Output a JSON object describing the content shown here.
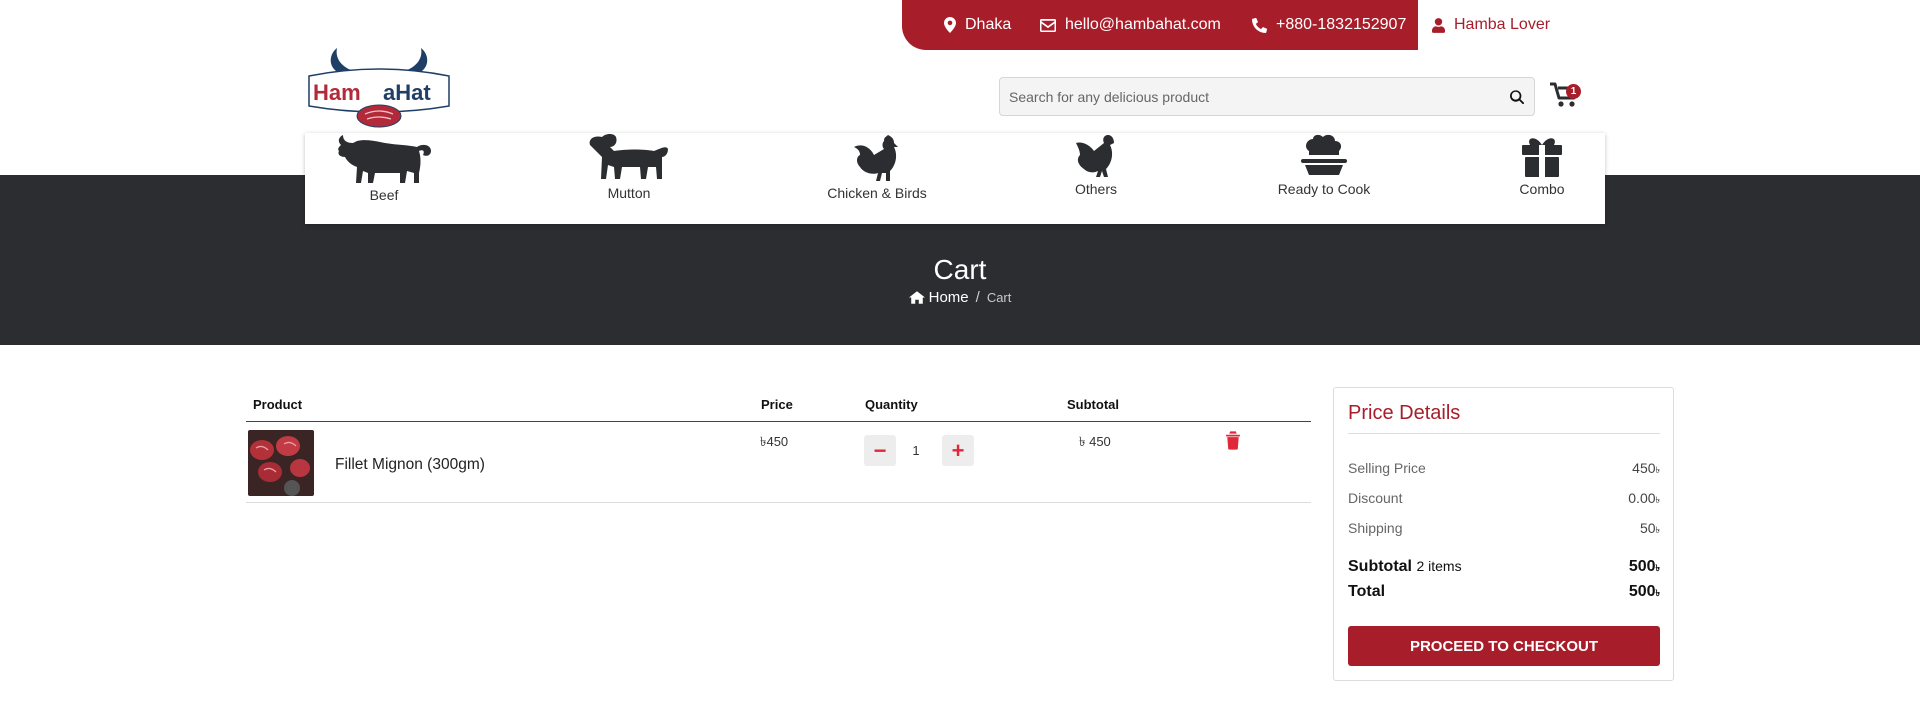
{
  "topbar": {
    "location": "Dhaka",
    "email": "hello@hambahat.com",
    "phone": "+880-1832152907",
    "user": "Hamba Lover"
  },
  "logo": {
    "text_left": "Ham",
    "text_right": "aHat"
  },
  "search": {
    "placeholder": "Search for any delicious product"
  },
  "cart": {
    "count": "1"
  },
  "categories": [
    {
      "label": "Beef",
      "icon": "bull-icon"
    },
    {
      "label": "Mutton",
      "icon": "goat-icon"
    },
    {
      "label": "Chicken & Birds",
      "icon": "rooster-icon"
    },
    {
      "label": "Others",
      "icon": "bird-icon"
    },
    {
      "label": "Ready to Cook",
      "icon": "chef-hat-icon"
    },
    {
      "label": "Combo",
      "icon": "gift-icon"
    }
  ],
  "page": {
    "title": "Cart",
    "breadcrumb_home": "Home",
    "breadcrumb_sep": "/",
    "breadcrumb_current": "Cart"
  },
  "table": {
    "headers": {
      "product": "Product",
      "price": "Price",
      "quantity": "Quantity",
      "subtotal": "Subtotal"
    },
    "rows": [
      {
        "name": "Fillet Mignon (300gm)",
        "price": "৳450",
        "quantity": "1",
        "subtotal": "৳ 450"
      }
    ],
    "minus": "−",
    "plus": "+"
  },
  "price_details": {
    "title": "Price Details",
    "selling_price_label": "Selling Price",
    "selling_price": "450",
    "discount_label": "Discount",
    "discount": "0.00",
    "shipping_label": "Shipping",
    "shipping": "50",
    "subtotal_label": "Subtotal",
    "subtotal_items": "2 items",
    "subtotal": "500",
    "total_label": "Total",
    "total": "500",
    "currency": "৳",
    "checkout_label": "PROCEED TO CHECKOUT"
  },
  "colors": {
    "brand_red": "#a81d2a",
    "hero_dark": "#2b2d31",
    "icon_red": "#e0283a"
  }
}
